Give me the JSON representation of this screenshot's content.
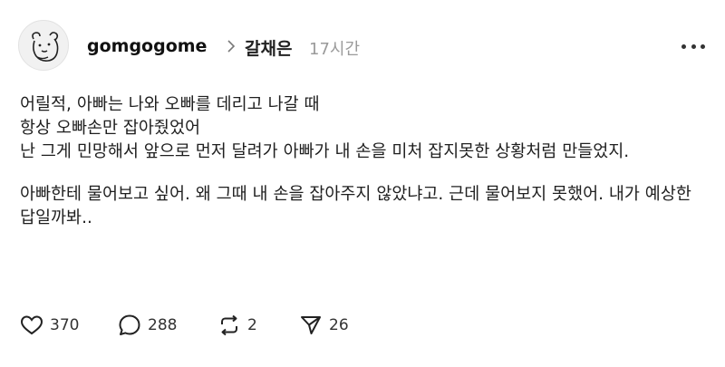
{
  "post": {
    "username": "gomgogome",
    "topic": "갈채은",
    "time": "17시간",
    "paragraphs": [
      "어릴적, 아빠는 나와 오빠를 데리고 나갈 때\n항상 오빠손만 잡아줬었어\n난 그게 민망해서 앞으로 먼저 달려가 아빠가 내 손을 미처 잡지못한 상황처럼 만들었지.",
      "아빠한테 물어보고 싶어. 왜 그때 내 손을 잡아주지 않았냐고. 근데 물어보지 못했어. 내가 예상한 답일까봐.."
    ],
    "actions": {
      "likes": "370",
      "replies": "288",
      "reposts": "2",
      "shares": "26"
    }
  },
  "icons": {
    "avatar": "bear-sketch-avatar",
    "separator": "chevron-right-icon",
    "more": "more-horizontal-icon",
    "like": "heart-icon",
    "reply": "speech-bubble-icon",
    "repost": "repost-arrows-icon",
    "share": "paper-plane-icon"
  },
  "colors": {
    "text": "#1f1f1f",
    "muted": "#9a9a9a",
    "background": "#ffffff"
  }
}
